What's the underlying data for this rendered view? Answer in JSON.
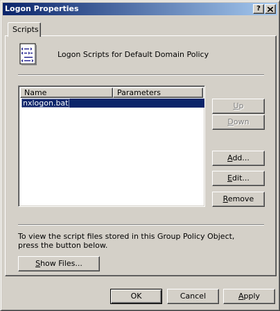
{
  "window": {
    "title": "Logon Properties",
    "help_button": "?",
    "close_button": "X"
  },
  "tabs": [
    {
      "label": "Scripts"
    }
  ],
  "header": {
    "icon": "script-file-icon",
    "text": "Logon Scripts for Default Domain Policy"
  },
  "list": {
    "columns": [
      "Name",
      "Parameters"
    ],
    "rows": [
      {
        "name": "nxlogon.bat",
        "parameters": ""
      }
    ]
  },
  "side_buttons": {
    "up": {
      "first": "U",
      "rest": "p"
    },
    "down": {
      "first": "D",
      "rest": "own"
    },
    "add": {
      "first": "A",
      "rest": "dd..."
    },
    "edit": {
      "first": "E",
      "rest": "dit..."
    },
    "remove": {
      "first": "R",
      "rest": "emove"
    }
  },
  "info_text": "To view the script files stored in this Group Policy Object, press the button below.",
  "show_files": {
    "first": "S",
    "rest": "how Files..."
  },
  "footer_buttons": {
    "ok": "OK",
    "cancel": "Cancel",
    "apply": {
      "first": "A",
      "rest": "pply"
    }
  }
}
